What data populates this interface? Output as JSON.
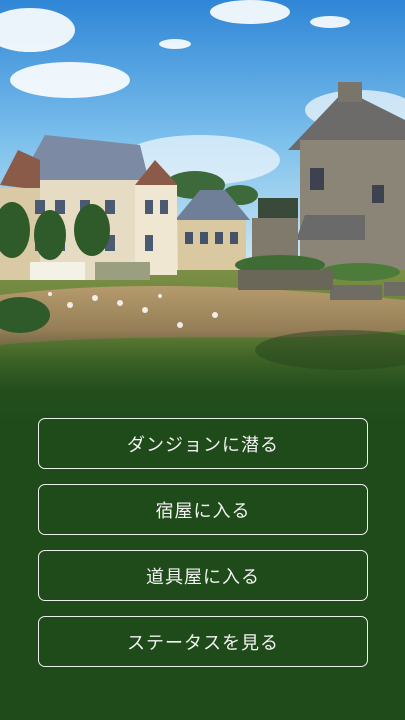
{
  "scene": {
    "description_icon": "town-square-illustration"
  },
  "menu": {
    "items": [
      {
        "label": "ダンジョンに潜る"
      },
      {
        "label": "宿屋に入る"
      },
      {
        "label": "道具屋に入る"
      },
      {
        "label": "ステータスを見る"
      }
    ]
  },
  "colors": {
    "background": "#1f4a1a",
    "button_border": "#ffffff",
    "button_text": "#f3f3f3"
  }
}
